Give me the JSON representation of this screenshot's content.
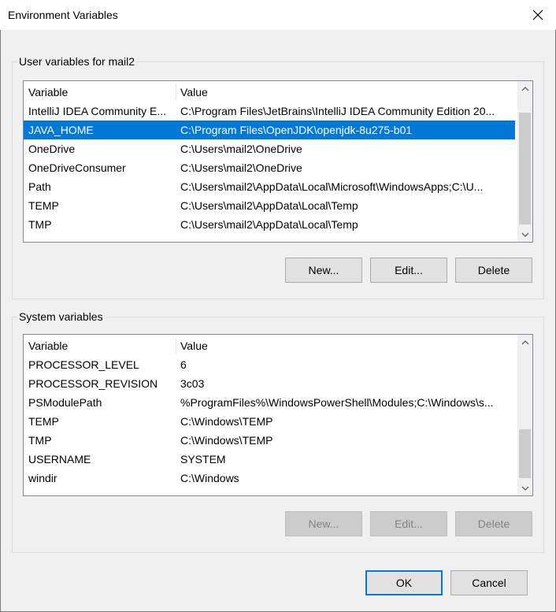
{
  "window": {
    "title": "Environment Variables"
  },
  "user_group": {
    "label": "User variables for mail2",
    "columns": [
      "Variable",
      "Value"
    ],
    "rows": [
      {
        "variable": "IntelliJ IDEA Community E...",
        "value": "C:\\Program Files\\JetBrains\\IntelliJ IDEA Community Edition 20..."
      },
      {
        "variable": "JAVA_HOME",
        "value": "C:\\Program Files\\OpenJDK\\openjdk-8u275-b01",
        "selected": true
      },
      {
        "variable": "OneDrive",
        "value": "C:\\Users\\mail2\\OneDrive"
      },
      {
        "variable": "OneDriveConsumer",
        "value": "C:\\Users\\mail2\\OneDrive"
      },
      {
        "variable": "Path",
        "value": "C:\\Users\\mail2\\AppData\\Local\\Microsoft\\WindowsApps;C:\\U..."
      },
      {
        "variable": "TEMP",
        "value": "C:\\Users\\mail2\\AppData\\Local\\Temp"
      },
      {
        "variable": "TMP",
        "value": "C:\\Users\\mail2\\AppData\\Local\\Temp"
      }
    ],
    "buttons": {
      "new": "New...",
      "edit": "Edit...",
      "delete": "Delete"
    }
  },
  "system_group": {
    "label": "System variables",
    "columns": [
      "Variable",
      "Value"
    ],
    "rows": [
      {
        "variable": "PROCESSOR_LEVEL",
        "value": "6"
      },
      {
        "variable": "PROCESSOR_REVISION",
        "value": "3c03"
      },
      {
        "variable": "PSModulePath",
        "value": "%ProgramFiles%\\WindowsPowerShell\\Modules;C:\\Windows\\s..."
      },
      {
        "variable": "TEMP",
        "value": "C:\\Windows\\TEMP"
      },
      {
        "variable": "TMP",
        "value": "C:\\Windows\\TEMP"
      },
      {
        "variable": "USERNAME",
        "value": "SYSTEM"
      },
      {
        "variable": "windir",
        "value": "C:\\Windows"
      }
    ],
    "buttons": {
      "new": "New...",
      "edit": "Edit...",
      "delete": "Delete"
    }
  },
  "footer": {
    "ok": "OK",
    "cancel": "Cancel"
  },
  "colors": {
    "selection": "#0078d7",
    "default_button_border": "#0078d7"
  }
}
